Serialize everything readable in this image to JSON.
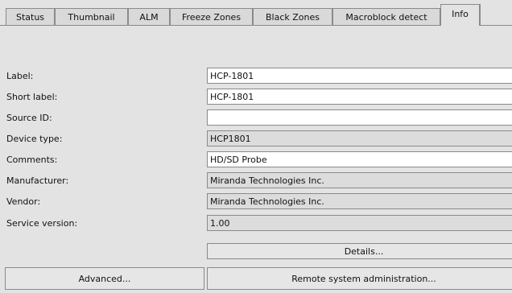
{
  "tabs": [
    {
      "label": "Status"
    },
    {
      "label": "Thumbnail"
    },
    {
      "label": "ALM"
    },
    {
      "label": "Freeze Zones"
    },
    {
      "label": "Black Zones"
    },
    {
      "label": "Macroblock detect"
    },
    {
      "label": "Info"
    }
  ],
  "active_tab": "Info",
  "fields": [
    {
      "label": "Label:",
      "value": "HCP-1801",
      "editable": true
    },
    {
      "label": "Short label:",
      "value": "HCP-1801",
      "editable": true
    },
    {
      "label": "Source ID:",
      "value": "",
      "editable": true
    },
    {
      "label": "Device type:",
      "value": "HCP1801",
      "editable": false
    },
    {
      "label": "Comments:",
      "value": "HD/SD Probe",
      "editable": true
    },
    {
      "label": "Manufacturer:",
      "value": "Miranda Technologies Inc.",
      "editable": false
    },
    {
      "label": "Vendor:",
      "value": "Miranda Technologies Inc.",
      "editable": false
    },
    {
      "label": "Service version:",
      "value": "1.00",
      "editable": false
    }
  ],
  "buttons": {
    "details": "Details...",
    "advanced": "Advanced...",
    "remote_admin": "Remote system administration..."
  },
  "colors": {
    "background": "#e3e3e3",
    "editable_field": "#ffffff",
    "readonly_field": "#dcdcdc",
    "border": "#8a8a8a"
  }
}
